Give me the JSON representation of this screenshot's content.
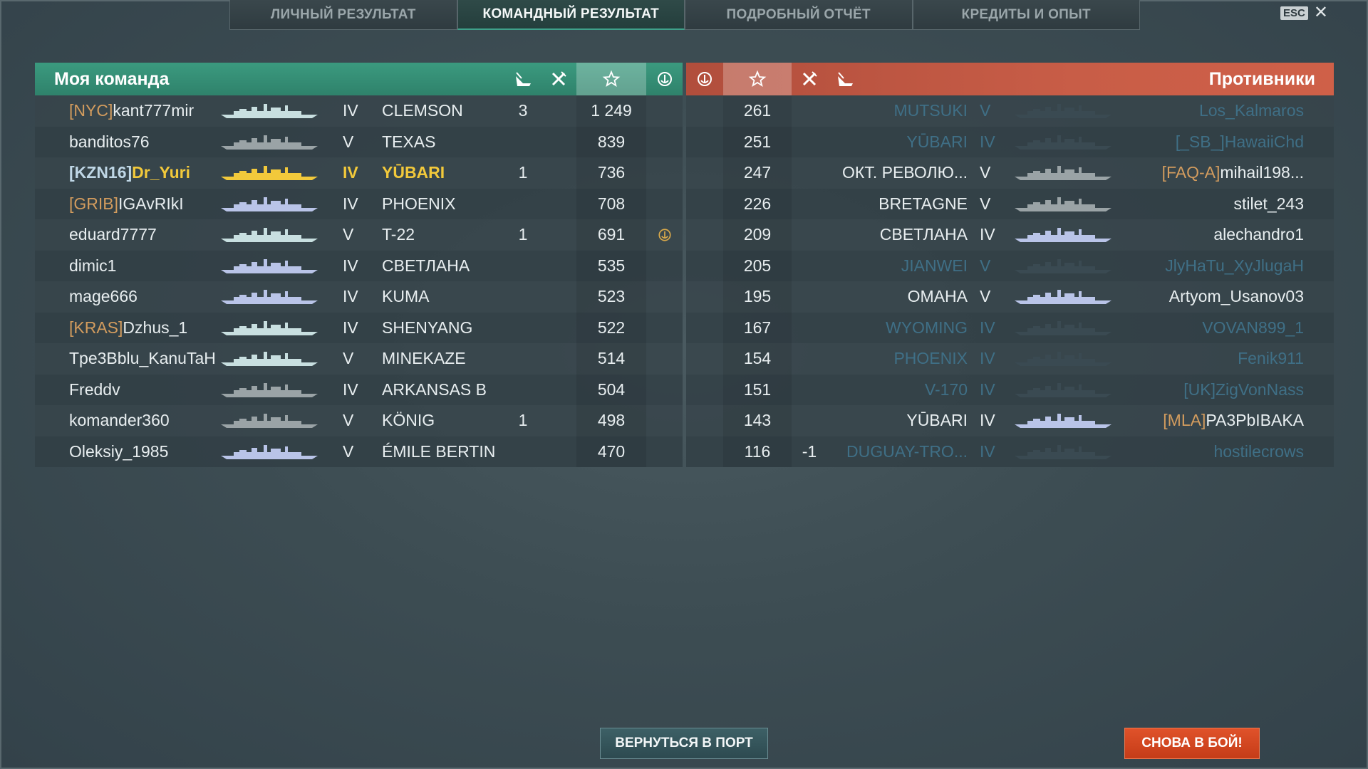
{
  "tabs": [
    {
      "label": "ЛИЧНЫЙ РЕЗУЛЬТАТ",
      "active": false
    },
    {
      "label": "КОМАНДНЫЙ РЕЗУЛЬТАТ",
      "active": true
    },
    {
      "label": "ПОДРОБНЫЙ ОТЧЁТ",
      "active": false
    },
    {
      "label": "КРЕДИТЫ И ОПЫТ",
      "active": false
    }
  ],
  "esc_label": "ESC",
  "close_glyph": "✕",
  "my_team_title": "Моя команда",
  "enemy_team_title": "Противники",
  "header_icons": [
    "ship-destroyed-icon",
    "planes-destroyed-icon",
    "score-star-icon",
    "base-capture-icon"
  ],
  "colors": {
    "my_team": "#3b9a7f",
    "enemy_team": "#c85d47",
    "clan_tag": "#d39c5e",
    "highlight": "#f2c93b",
    "dead": "#3f6f86",
    "battle_button": "#d8471f"
  },
  "my_team": [
    {
      "clan": "[NYC]",
      "name": "kant777mir",
      "tier": "IV",
      "ship": "CLEMSON",
      "kills": "3",
      "score": "1 249",
      "cap": "",
      "ship_color": "#c8dfe0",
      "highlight": false
    },
    {
      "clan": "",
      "name": "banditos76",
      "tier": "V",
      "ship": "TEXAS",
      "kills": "",
      "score": "839",
      "cap": "",
      "ship_color": "#9aa3a6",
      "highlight": false
    },
    {
      "clan": "[KZN16]",
      "name": "Dr_Yuri",
      "tier": "IV",
      "ship": "YŪBARI",
      "kills": "1",
      "score": "736",
      "cap": "",
      "ship_color": "#f2c93b",
      "highlight": true
    },
    {
      "clan": "[GRIB]",
      "name": "IGAvRIkI",
      "tier": "IV",
      "ship": "PHOENIX",
      "kills": "",
      "score": "708",
      "cap": "",
      "ship_color": "#b9c4e8",
      "highlight": false
    },
    {
      "clan": "",
      "name": "eduard7777",
      "tier": "V",
      "ship": "T-22",
      "kills": "1",
      "score": "691",
      "cap": "capture-icon",
      "ship_color": "#c8dfe0",
      "highlight": false
    },
    {
      "clan": "",
      "name": "dimic1",
      "tier": "IV",
      "ship": "СВЕТЛАНА",
      "kills": "",
      "score": "535",
      "cap": "",
      "ship_color": "#b9c4e8",
      "highlight": false
    },
    {
      "clan": "",
      "name": "mage666",
      "tier": "IV",
      "ship": "KUMA",
      "kills": "",
      "score": "523",
      "cap": "",
      "ship_color": "#b9c4e8",
      "highlight": false
    },
    {
      "clan": "[KRAS]",
      "name": "Dzhus_1",
      "tier": "IV",
      "ship": "SHENYANG",
      "kills": "",
      "score": "522",
      "cap": "",
      "ship_color": "#c8dfe0",
      "highlight": false
    },
    {
      "clan": "",
      "name": "Tpe3Bblu_KanuTaH",
      "tier": "V",
      "ship": "MINEKAZE",
      "kills": "",
      "score": "514",
      "cap": "",
      "ship_color": "#c8dfe0",
      "highlight": false
    },
    {
      "clan": "",
      "name": "Freddv",
      "tier": "IV",
      "ship": "ARKANSAS B",
      "kills": "",
      "score": "504",
      "cap": "",
      "ship_color": "#9aa3a6",
      "highlight": false
    },
    {
      "clan": "",
      "name": "komander360",
      "tier": "V",
      "ship": "KÖNIG",
      "kills": "1",
      "score": "498",
      "cap": "",
      "ship_color": "#9aa3a6",
      "highlight": false
    },
    {
      "clan": "",
      "name": "Oleksiy_1985",
      "tier": "V",
      "ship": "ÉMILE BERTIN",
      "kills": "",
      "score": "470",
      "cap": "",
      "ship_color": "#b9c4e8",
      "highlight": false
    }
  ],
  "enemy_team": [
    {
      "score": "261",
      "kills": "",
      "ship": "MUTSUKI",
      "tier": "V",
      "clan": "",
      "name": "Los_Kalmaros",
      "dead": true,
      "ship_color": "#3a4a52"
    },
    {
      "score": "251",
      "kills": "",
      "ship": "YŪBARI",
      "tier": "IV",
      "clan": "[_SB_]",
      "name": "HawaiiChd",
      "dead": true,
      "ship_color": "#3a4a52"
    },
    {
      "score": "247",
      "kills": "",
      "ship": "ОКТ. РЕВОЛЮ...",
      "tier": "V",
      "clan": "[FAQ-A]",
      "name": "mihail198...",
      "dead": false,
      "ship_color": "#9aa3a6"
    },
    {
      "score": "226",
      "kills": "",
      "ship": "BRETAGNE",
      "tier": "V",
      "clan": "",
      "name": "stilet_243",
      "dead": false,
      "ship_color": "#9aa3a6"
    },
    {
      "score": "209",
      "kills": "",
      "ship": "СВЕТЛАНА",
      "tier": "IV",
      "clan": "",
      "name": "alechandro1",
      "dead": false,
      "ship_color": "#b9c4e8"
    },
    {
      "score": "205",
      "kills": "",
      "ship": "JIANWEI",
      "tier": "V",
      "clan": "",
      "name": "JlyHaTu_XyJlugaH",
      "dead": true,
      "ship_color": "#3a4a52"
    },
    {
      "score": "195",
      "kills": "",
      "ship": "OMAHA",
      "tier": "V",
      "clan": "",
      "name": "Artyom_Usanov03",
      "dead": false,
      "ship_color": "#b9c4e8"
    },
    {
      "score": "167",
      "kills": "",
      "ship": "WYOMING",
      "tier": "IV",
      "clan": "",
      "name": "VOVAN899_1",
      "dead": true,
      "ship_color": "#3a4a52"
    },
    {
      "score": "154",
      "kills": "",
      "ship": "PHOENIX",
      "tier": "IV",
      "clan": "",
      "name": "Fenik911",
      "dead": true,
      "ship_color": "#3a4a52"
    },
    {
      "score": "151",
      "kills": "",
      "ship": "V-170",
      "tier": "IV",
      "clan": "[UK]",
      "name": "ZigVonNass",
      "dead": true,
      "ship_color": "#3a4a52"
    },
    {
      "score": "143",
      "kills": "",
      "ship": "YŪBARI",
      "tier": "IV",
      "clan": "[MLA]",
      "name": "PA3PbIBAKA",
      "dead": false,
      "ship_color": "#b9c4e8"
    },
    {
      "score": "116",
      "kills": "-1",
      "ship": "DUGUAY-TRO...",
      "tier": "IV",
      "clan": "",
      "name": "hostilecrows",
      "dead": true,
      "ship_color": "#3a4a52"
    }
  ],
  "buttons": {
    "return_port": "ВЕРНУТЬСЯ В ПОРТ",
    "battle_again": "СНОВА В БОЙ!"
  }
}
